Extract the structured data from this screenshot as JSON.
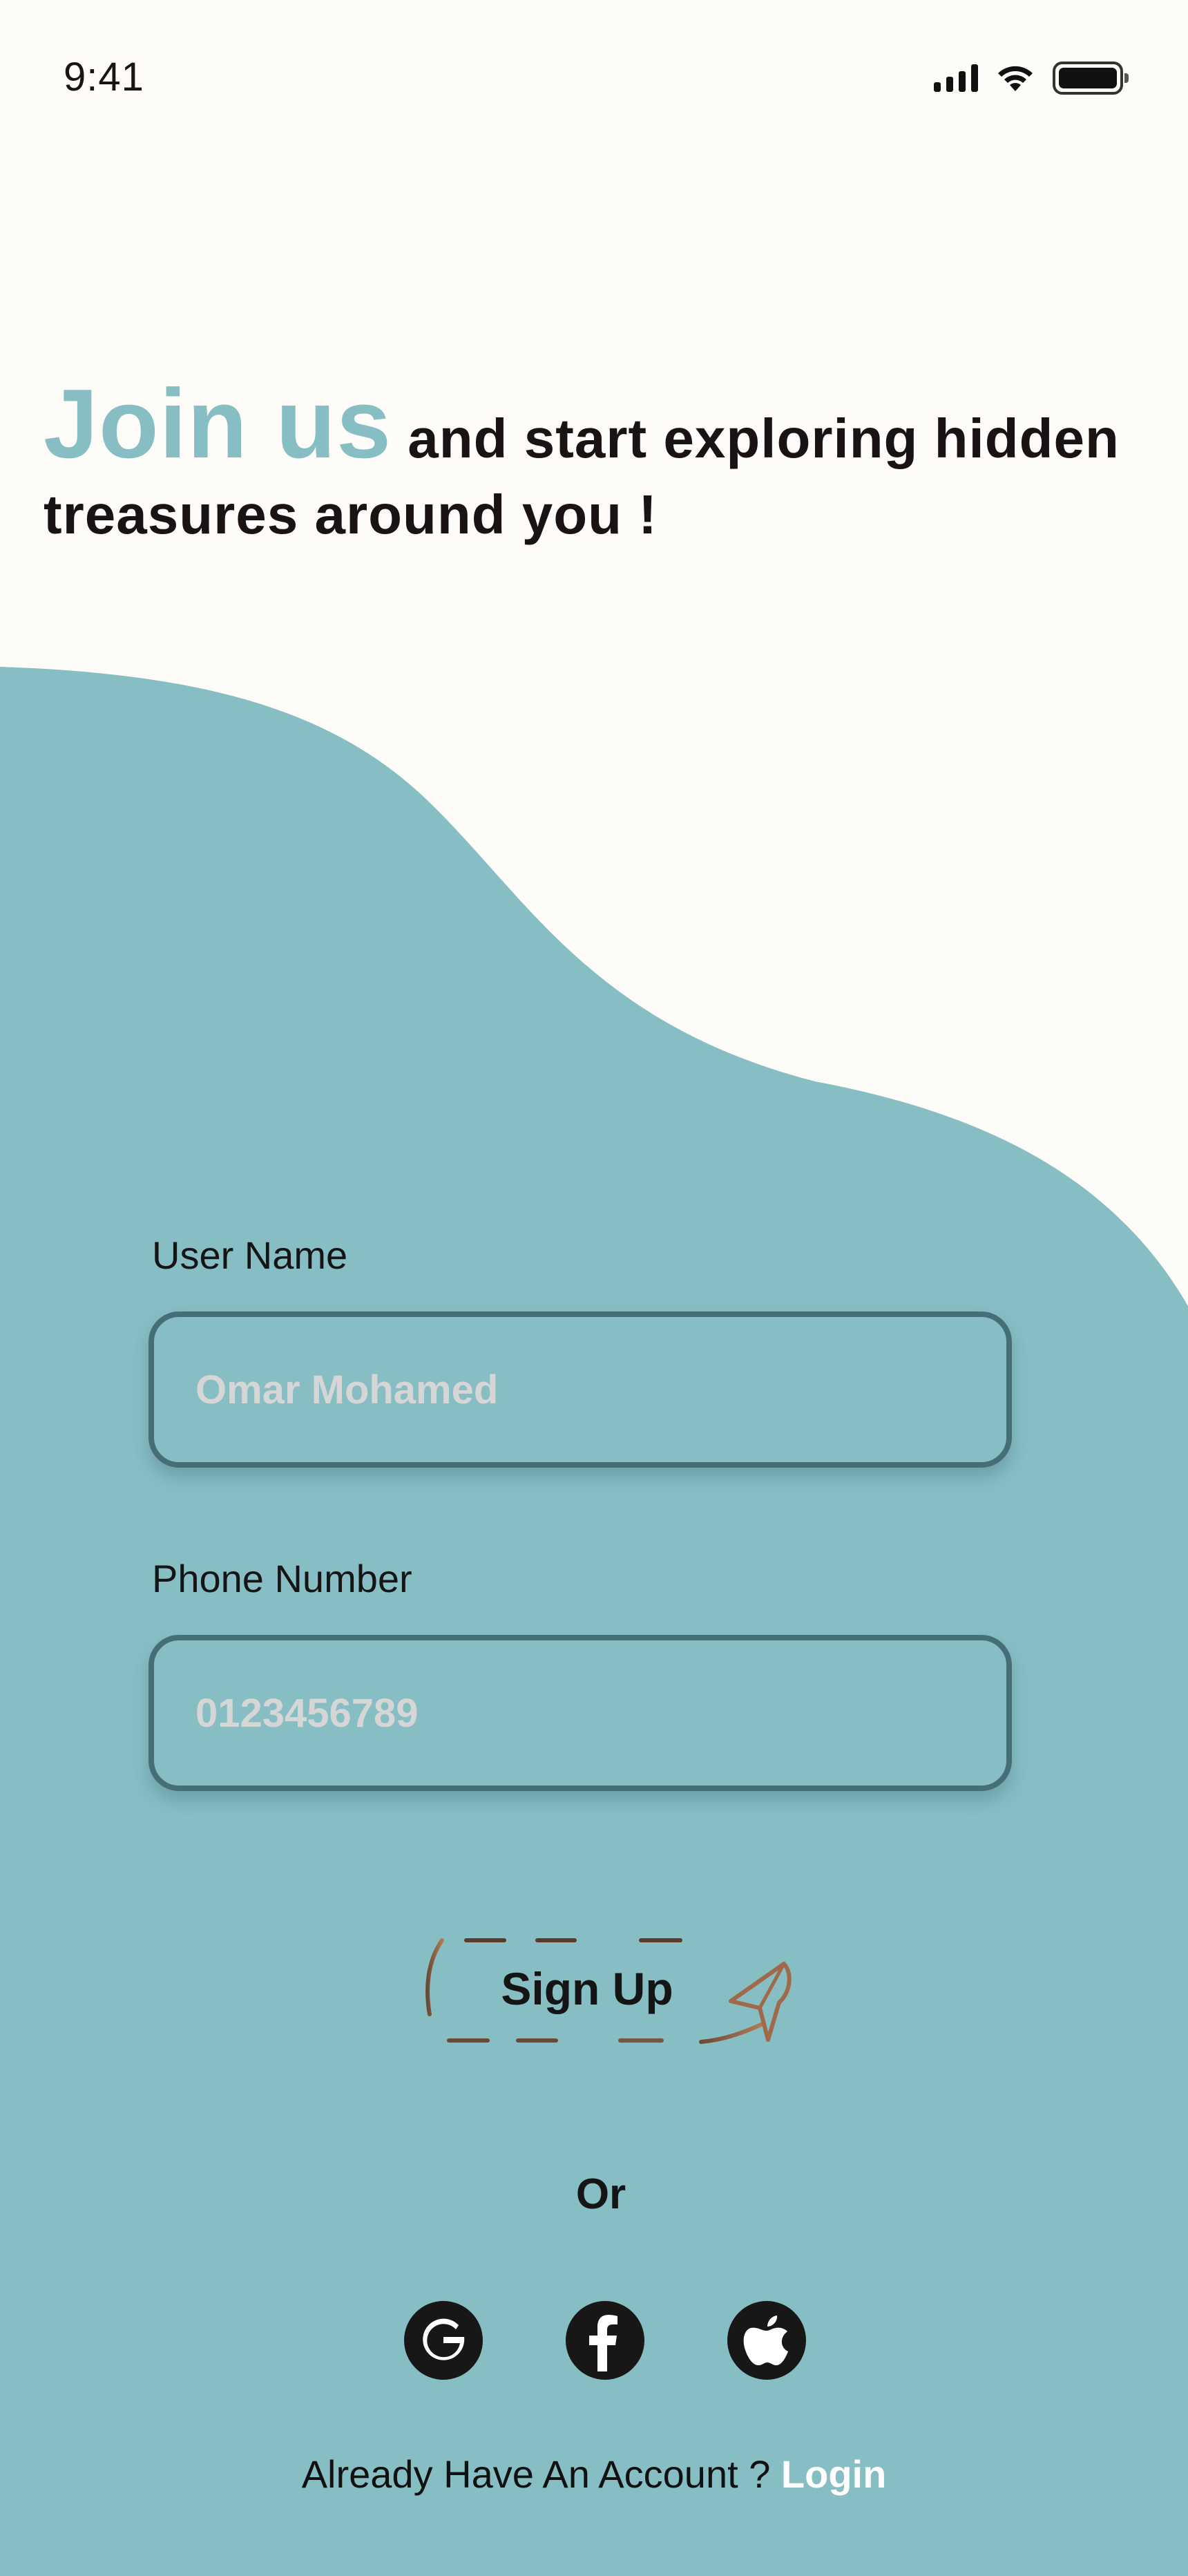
{
  "status_bar": {
    "time": "9:41",
    "icons": [
      "signal-icon",
      "wifi-icon",
      "battery-icon"
    ]
  },
  "headline": {
    "accent": "Join us",
    "rest": " and start exploring hidden treasures around you !"
  },
  "form": {
    "username_label": "User Name",
    "username_placeholder": "Omar Mohamed",
    "phone_label": "Phone Number",
    "phone_placeholder": "0123456789"
  },
  "signup": {
    "label": "Sign Up",
    "icon": "paper-plane-icon"
  },
  "divider_text": "Or",
  "social": [
    {
      "icon": "google-icon"
    },
    {
      "icon": "facebook-icon"
    },
    {
      "icon": "apple-icon"
    }
  ],
  "footer": {
    "prompt": "Already Have An Account ? ",
    "login_link": "Login"
  },
  "colors": {
    "background": "#FDFCF8",
    "accent": "#86BEC3",
    "input_border": "#466E77",
    "signup_outline": "#8B5A3C",
    "text": "#151515",
    "placeholder": "#D6D6D6",
    "link": "#FFFFFF"
  }
}
